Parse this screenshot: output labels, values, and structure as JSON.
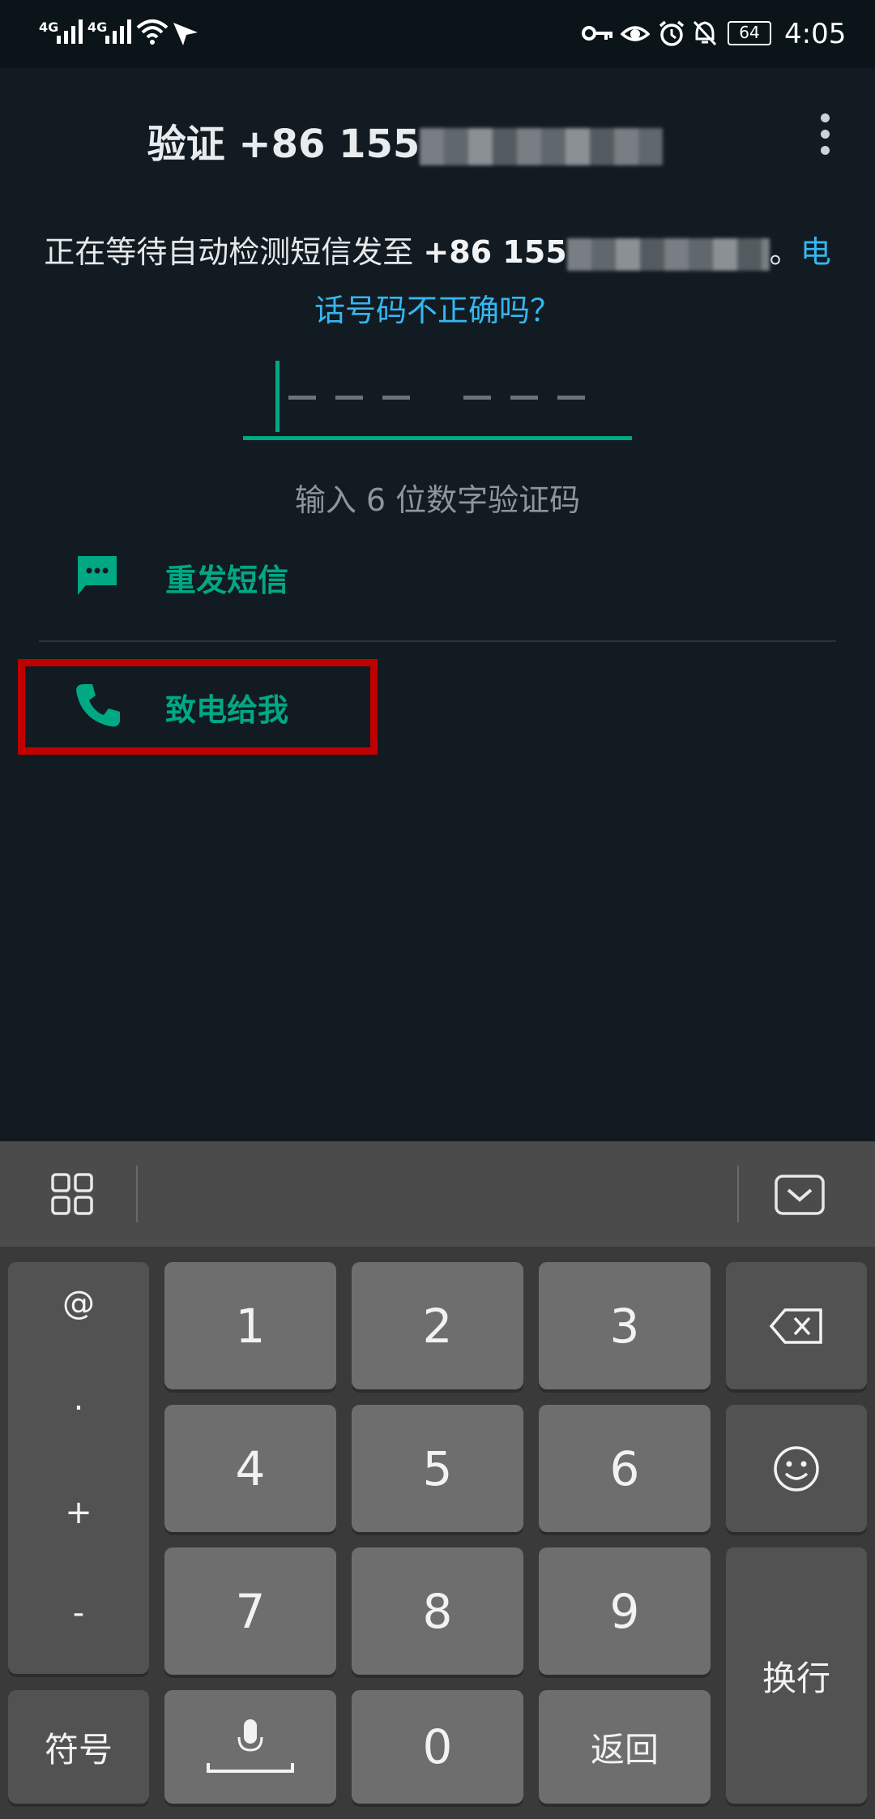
{
  "status_bar": {
    "network_1": "4G",
    "network_2": "4G",
    "battery": "64",
    "time": "4:05",
    "icons": [
      "signal-icon",
      "signal-icon",
      "wifi-icon",
      "location-arrow-icon",
      "key-icon",
      "eye-icon",
      "alarm-icon",
      "bell-off-icon",
      "battery-icon"
    ]
  },
  "header": {
    "title_prefix": "验证 +86 155",
    "menu_icon": "more-vert-icon"
  },
  "description": {
    "line1_prefix": "正在等待自动检测短信发至 ",
    "line1_number": "+86 155",
    "line1_suffix": "。",
    "line1_link_start": "电",
    "line2_link": "话号码不正确吗？"
  },
  "code_input": {
    "hint": "输入 6 位数字验证码",
    "digits": 6
  },
  "options": {
    "resend_sms": "重发短信",
    "call_me": "致电给我"
  },
  "keyboard": {
    "symbols_left": [
      "@",
      ".",
      "+",
      "-"
    ],
    "digits": [
      "1",
      "2",
      "3",
      "4",
      "5",
      "6",
      "7",
      "8",
      "9",
      "0"
    ],
    "symbol_key": "符号",
    "return_key": "返回",
    "enter_key": "换行",
    "icons": [
      "grid-icon",
      "keyboard-hide-icon",
      "backspace-icon",
      "emoji-icon",
      "microphone-icon"
    ]
  },
  "colors": {
    "accent": "#00a884",
    "link": "#34b7f1",
    "background": "#121b22",
    "highlight": "#c00000"
  }
}
